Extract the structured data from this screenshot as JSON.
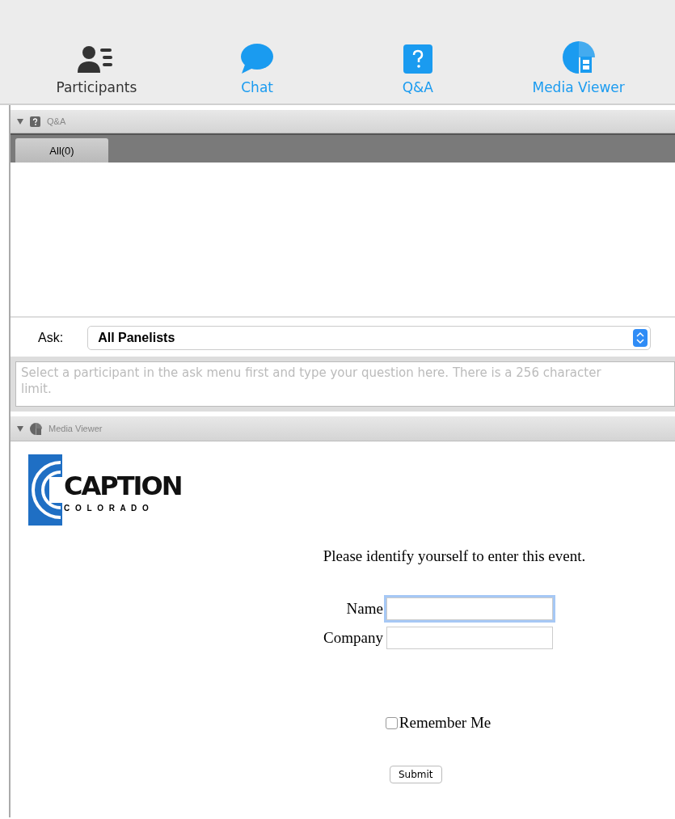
{
  "toolbar": [
    {
      "label": "Participants",
      "kind": "participants",
      "color": "#333333"
    },
    {
      "label": "Chat",
      "kind": "chat",
      "color": "#1a9bf0"
    },
    {
      "label": "Q&A",
      "kind": "qa",
      "color": "#1a9bf0"
    },
    {
      "label": "Media Viewer",
      "kind": "media",
      "color": "#1a9bf0"
    }
  ],
  "qa_panel": {
    "title": "Q&A",
    "expanded": true,
    "tabs": [
      {
        "label": "All(0)",
        "selected": true
      }
    ],
    "ask_label": "Ask:",
    "ask_value": "All Panelists",
    "question_placeholder": "Select a participant in the ask menu first and type your question here. There is a 256 character limit."
  },
  "media_panel": {
    "title": "Media Viewer",
    "expanded": true,
    "logo": {
      "name": "CAPTION",
      "tagline": "C O L O R A D O"
    },
    "prompt": "Please identify yourself to enter this event.",
    "fields": [
      {
        "label": "Name",
        "focused": true
      },
      {
        "label": "Company",
        "focused": false
      }
    ],
    "remember": {
      "label": "Remember Me",
      "checked": false
    },
    "submit": "Submit"
  }
}
